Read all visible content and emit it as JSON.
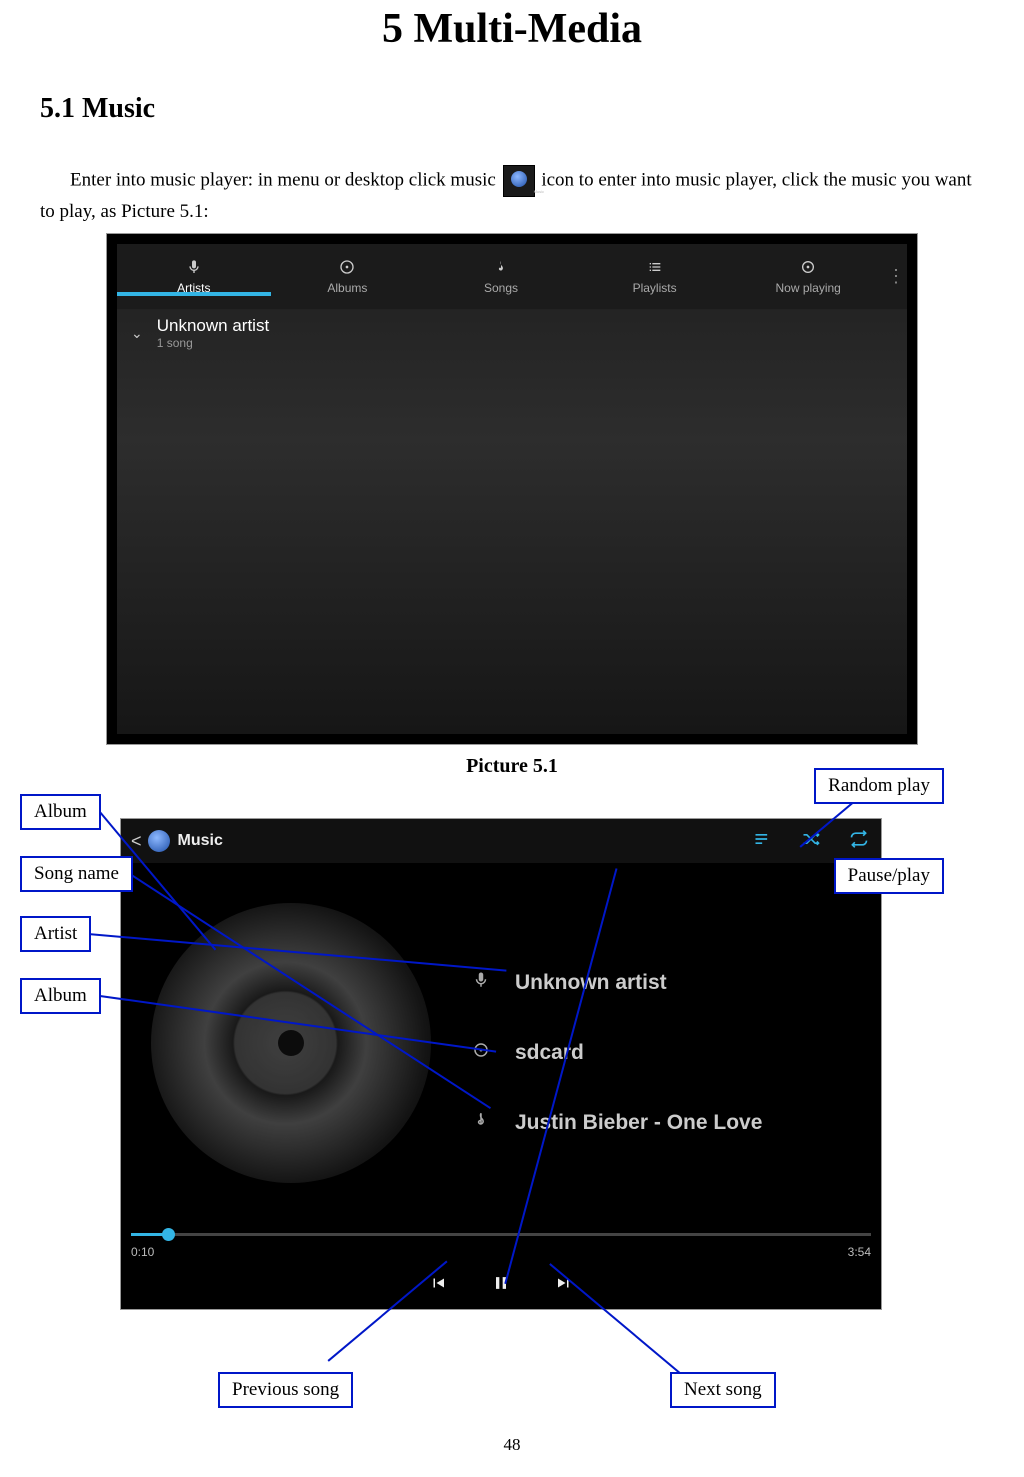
{
  "chapter_title": "5 Multi-Media",
  "section_title": "5.1 Music",
  "para1_pre": "Enter into music player: in menu or desktop click music ",
  "para1_post": " icon to enter into music player, click the music you want to play, as Picture 5.1:",
  "caption1": "Picture 5.1",
  "page_number": "48",
  "ss1": {
    "tabs": [
      "Artists",
      "Albums",
      "Songs",
      "Playlists",
      "Now playing"
    ],
    "artist": "Unknown artist",
    "song_count": "1 song"
  },
  "ss2": {
    "header_title": "Music",
    "np_artist": "Unknown artist",
    "np_album": "sdcard",
    "np_song": "Justin Bieber - One Love",
    "elapsed": "0:10",
    "total": "3:54"
  },
  "callouts": {
    "album_art": "Album",
    "song_name": "Song name",
    "artist": "Artist",
    "album": "Album",
    "random_play": "Random play",
    "pause_play": "Pause/play",
    "previous": "Previous song",
    "next": "Next song"
  }
}
